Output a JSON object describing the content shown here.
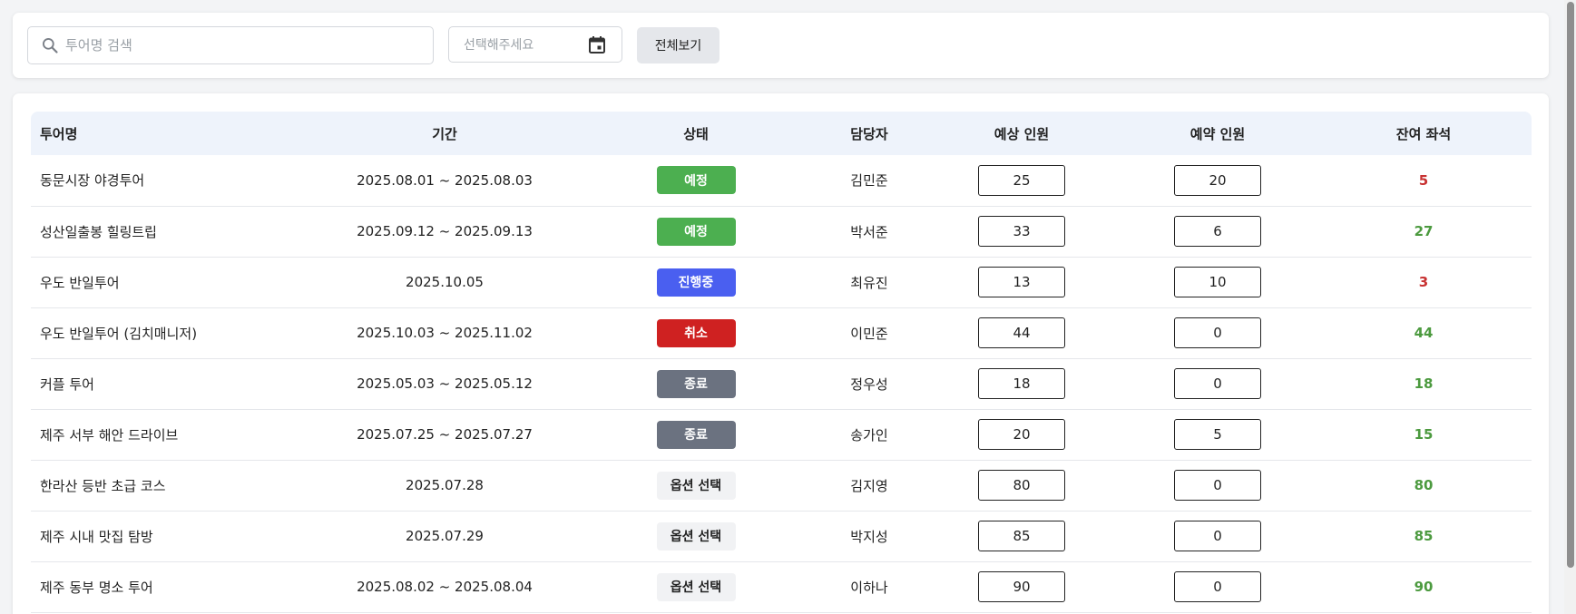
{
  "search": {
    "placeholder": "투어명 검색"
  },
  "date_filter": {
    "placeholder": "선택해주세요"
  },
  "view_all_label": "전체보기",
  "table": {
    "headers": {
      "name": "투어명",
      "period": "기간",
      "status": "상태",
      "manager": "담당자",
      "expected": "예상 인원",
      "booked": "예약 인원",
      "remaining": "잔여 좌석"
    },
    "rows": [
      {
        "name": "동문시장 야경투어",
        "period": "2025.08.01 ~ 2025.08.03",
        "status": "예정",
        "status_type": "scheduled",
        "manager": "김민준",
        "expected": "25",
        "booked": "20",
        "remaining": "5",
        "remaining_level": "low"
      },
      {
        "name": "성산일출봉 힐링트립",
        "period": "2025.09.12 ~ 2025.09.13",
        "status": "예정",
        "status_type": "scheduled",
        "manager": "박서준",
        "expected": "33",
        "booked": "6",
        "remaining": "27",
        "remaining_level": "ok"
      },
      {
        "name": "우도 반일투어",
        "period": "2025.10.05",
        "status": "진행중",
        "status_type": "in-progress",
        "manager": "최유진",
        "expected": "13",
        "booked": "10",
        "remaining": "3",
        "remaining_level": "low"
      },
      {
        "name": "우도 반일투어 (김치매니저)",
        "period": "2025.10.03 ~ 2025.11.02",
        "status": "취소",
        "status_type": "cancelled",
        "manager": "이민준",
        "expected": "44",
        "booked": "0",
        "remaining": "44",
        "remaining_level": "ok"
      },
      {
        "name": "커플 투어",
        "period": "2025.05.03 ~ 2025.05.12",
        "status": "종료",
        "status_type": "ended",
        "manager": "정우성",
        "expected": "18",
        "booked": "0",
        "remaining": "18",
        "remaining_level": "ok"
      },
      {
        "name": "제주 서부 해안 드라이브",
        "period": "2025.07.25 ~ 2025.07.27",
        "status": "종료",
        "status_type": "ended",
        "manager": "송가인",
        "expected": "20",
        "booked": "5",
        "remaining": "15",
        "remaining_level": "ok"
      },
      {
        "name": "한라산 등반 초급 코스",
        "period": "2025.07.28",
        "status": "옵션 선택",
        "status_type": "option",
        "manager": "김지영",
        "expected": "80",
        "booked": "0",
        "remaining": "80",
        "remaining_level": "ok"
      },
      {
        "name": "제주 시내 맛집 탐방",
        "period": "2025.07.29",
        "status": "옵션 선택",
        "status_type": "option",
        "manager": "박지성",
        "expected": "85",
        "booked": "0",
        "remaining": "85",
        "remaining_level": "ok"
      },
      {
        "name": "제주 동부 명소 투어",
        "period": "2025.08.02 ~ 2025.08.04",
        "status": "옵션 선택",
        "status_type": "option",
        "manager": "이하나",
        "expected": "90",
        "booked": "0",
        "remaining": "90",
        "remaining_level": "ok"
      }
    ]
  },
  "colors": {
    "scheduled": "#4caf50",
    "in_progress": "#4a5ff0",
    "cancelled": "#cf2121",
    "ended": "#6b7280",
    "remaining_low": "#c83232",
    "remaining_ok": "#4c9a3f",
    "header_bg": "#eef3fb"
  },
  "icons": {
    "search": "search-icon",
    "calendar": "calendar-icon"
  }
}
